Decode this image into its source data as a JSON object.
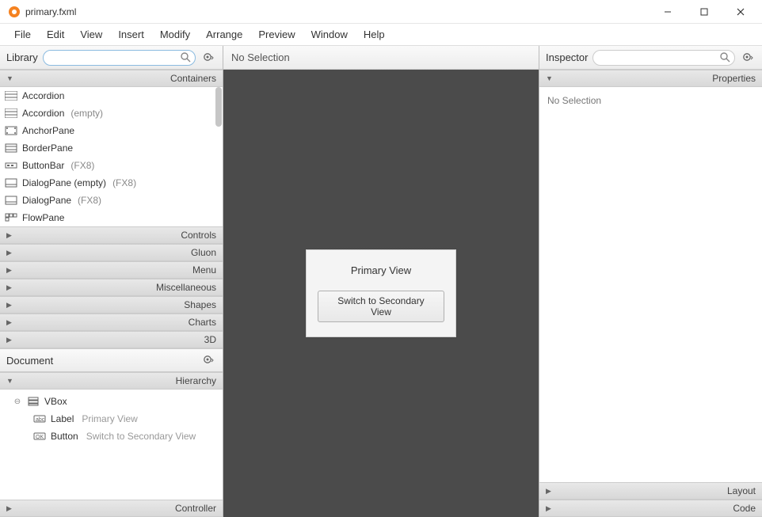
{
  "window": {
    "title": "primary.fxml"
  },
  "menu": {
    "items": [
      "File",
      "Edit",
      "View",
      "Insert",
      "Modify",
      "Arrange",
      "Preview",
      "Window",
      "Help"
    ]
  },
  "library": {
    "title": "Library",
    "search_placeholder": "",
    "sections": {
      "containers": "Containers",
      "controls": "Controls",
      "gluon": "Gluon",
      "menu": "Menu",
      "miscellaneous": "Miscellaneous",
      "shapes": "Shapes",
      "charts": "Charts",
      "three_d": "3D"
    },
    "container_items": [
      {
        "name": "Accordion",
        "suffix": ""
      },
      {
        "name": "Accordion",
        "suffix": "(empty)"
      },
      {
        "name": "AnchorPane",
        "suffix": ""
      },
      {
        "name": "BorderPane",
        "suffix": ""
      },
      {
        "name": "ButtonBar",
        "suffix": "(FX8)"
      },
      {
        "name": "DialogPane (empty)",
        "suffix": "(FX8)"
      },
      {
        "name": "DialogPane",
        "suffix": "(FX8)"
      },
      {
        "name": "FlowPane",
        "suffix": ""
      }
    ]
  },
  "document": {
    "title": "Document",
    "hierarchy_label": "Hierarchy",
    "controller_label": "Controller",
    "tree": {
      "root": {
        "type": "VBox",
        "text": ""
      },
      "children": [
        {
          "type": "Label",
          "text": "Primary View"
        },
        {
          "type": "Button",
          "text": "Switch to Secondary View"
        }
      ]
    }
  },
  "center": {
    "status": "No Selection",
    "preview": {
      "label": "Primary View",
      "button": "Switch to Secondary View"
    }
  },
  "inspector": {
    "title": "Inspector",
    "search_placeholder": "",
    "sections": {
      "properties": "Properties",
      "layout": "Layout",
      "code": "Code"
    },
    "body_text": "No Selection"
  }
}
